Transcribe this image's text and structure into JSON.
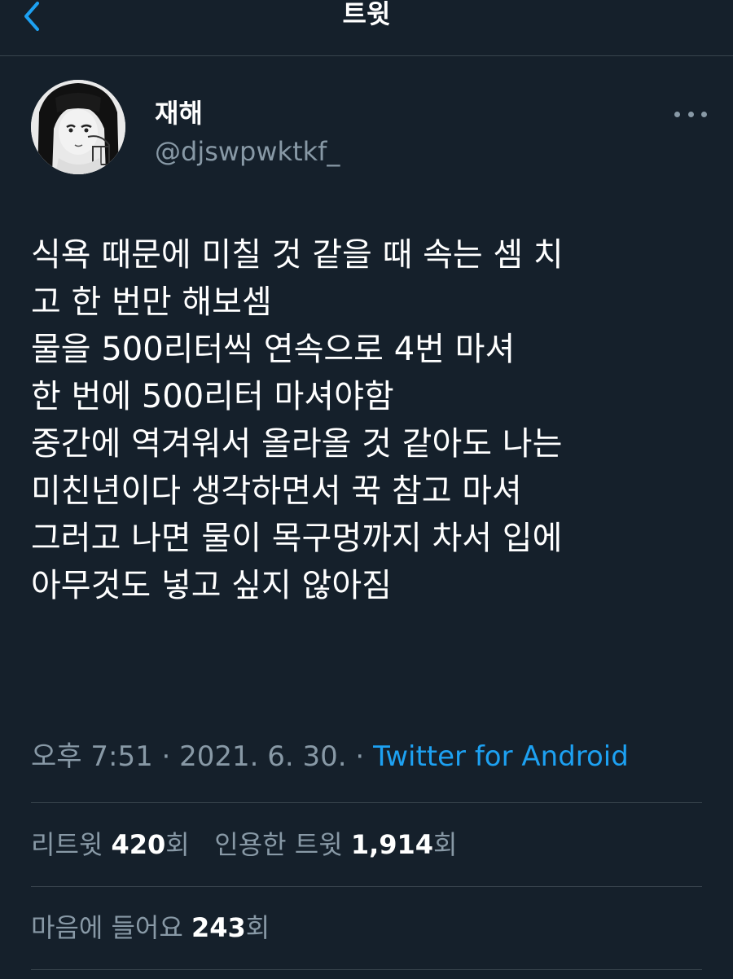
{
  "header": {
    "title": "트윗"
  },
  "tweet": {
    "author": {
      "display_name": "재해",
      "handle": "@djswpwktkf_"
    },
    "lines": [
      "식욕 때문에 미칠 것 같을 때 속는 셈 치",
      "고 한 번만 해보셈",
      "물을 500리터씩 연속으로 4번 마셔",
      "한 번에 500리터 마셔야함",
      "중간에 역겨워서 올라올 것 같아도 나는",
      "미친년이다 생각하면서 꾹 참고 마셔",
      "그러고 나면 물이 목구멍까지 차서 입에",
      "아무것도 넣고 싶지 않아짐"
    ],
    "meta": {
      "time": "오후 7:51",
      "sep1": " · ",
      "date": "2021. 6. 30.",
      "sep2": " · ",
      "source": "Twitter for Android"
    },
    "stats": {
      "retweets_label": "리트윗 ",
      "retweets_count": "420",
      "retweets_unit": "회",
      "quotes_label": "인용한 트윗 ",
      "quotes_count": "1,914",
      "quotes_unit": "회",
      "likes_label": "마음에 들어요 ",
      "likes_count": "243",
      "likes_unit": "회"
    }
  },
  "colors": {
    "background": "#15202b",
    "accent": "#1da1f2",
    "muted": "#8899a6",
    "divider": "#38444d"
  }
}
